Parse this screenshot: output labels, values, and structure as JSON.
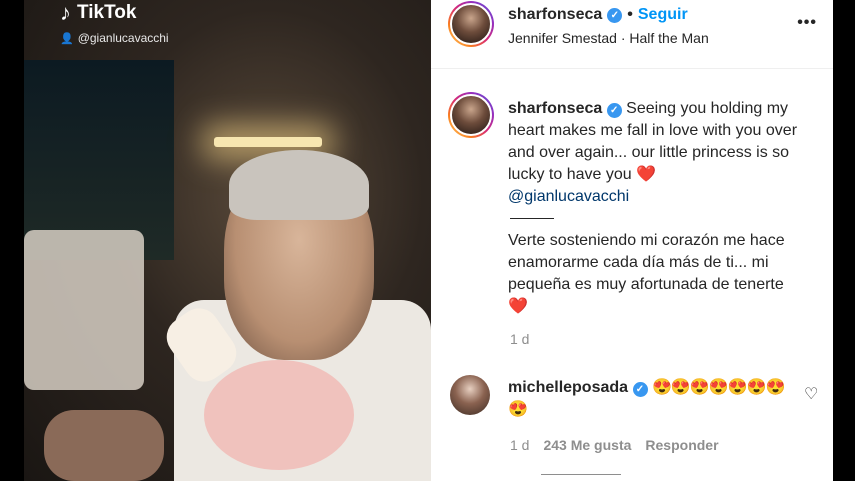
{
  "media": {
    "source_app": "TikTok",
    "source_handle": "@gianlucavacchi"
  },
  "post": {
    "author": "sharfonseca",
    "separator": "•",
    "follow_label": "Seguir",
    "song": "Jennifer Smestad · Half the Man",
    "more_label": "•••"
  },
  "caption": {
    "author": "sharfonseca",
    "text_en": "Seeing you holding my heart makes me fall in love with you over and over again... our little princess is so lucky to have you",
    "mention": "@gianlucavacchi",
    "text_es": "Verte sosteniendo mi corazón me hace enamorarme cada día más de ti... mi pequeña es muy afortunada de tenerte",
    "time": "1 d"
  },
  "comment": {
    "author": "michelleposada",
    "emojis": "😍😍😍😍😍😍😍",
    "emojis_line2": "😍",
    "time": "1 d",
    "likes": "243 Me gusta",
    "reply_label": "Responder"
  },
  "colors": {
    "verified": "#3897f0",
    "follow": "#0095f6",
    "mention": "#00376b",
    "heart": "#e0245e"
  }
}
